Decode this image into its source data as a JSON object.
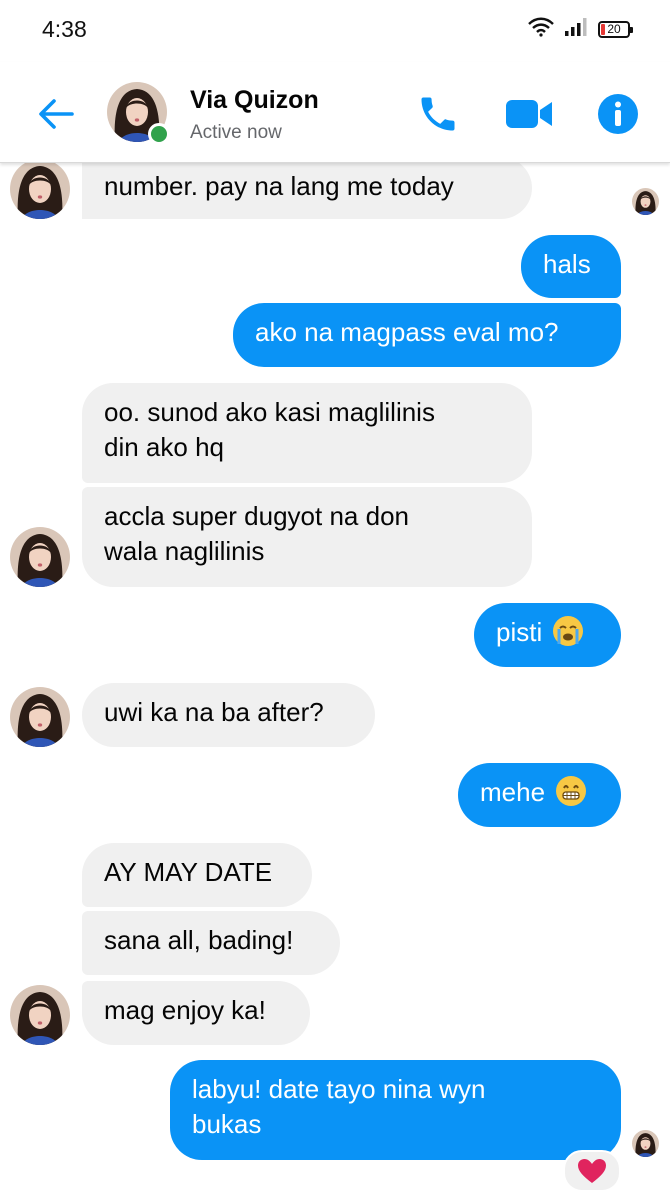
{
  "status_bar": {
    "time": "4:38",
    "battery": "20"
  },
  "header": {
    "contact_name": "Via Quizon",
    "contact_status": "Active now"
  },
  "messages": [
    {
      "id": "m1",
      "direction": "incoming",
      "text": "number. pay na lang me today"
    },
    {
      "id": "m2",
      "direction": "outgoing",
      "text": "hals"
    },
    {
      "id": "m3",
      "direction": "outgoing",
      "text": "ako na magpass eval mo?"
    },
    {
      "id": "m4",
      "direction": "incoming",
      "lines": [
        "oo. sunod ako kasi maglilinis",
        "din ako hq"
      ]
    },
    {
      "id": "m5",
      "direction": "incoming",
      "lines": [
        "accla super dugyot na don",
        "wala naglilinis"
      ]
    },
    {
      "id": "m6",
      "direction": "outgoing",
      "text": "pisti",
      "emoji": "crying-face"
    },
    {
      "id": "m7",
      "direction": "incoming",
      "text": "uwi ka na ba after?"
    },
    {
      "id": "m8",
      "direction": "outgoing",
      "text": "mehe",
      "emoji": "grinning-face"
    },
    {
      "id": "m9",
      "direction": "incoming",
      "text": "AY MAY DATE"
    },
    {
      "id": "m10",
      "direction": "incoming",
      "text": "sana all, bading!"
    },
    {
      "id": "m11",
      "direction": "incoming",
      "text": "mag enjoy ka!"
    },
    {
      "id": "m12",
      "direction": "outgoing",
      "lines": [
        "labyu! date tayo nina wyn",
        "bukas"
      ],
      "reaction": "heart"
    }
  ],
  "colors": {
    "accent": "#0a93f6",
    "incoming_bubble": "#f0f0f0",
    "online": "#31a24c",
    "reaction_heart": "#e0245e"
  }
}
